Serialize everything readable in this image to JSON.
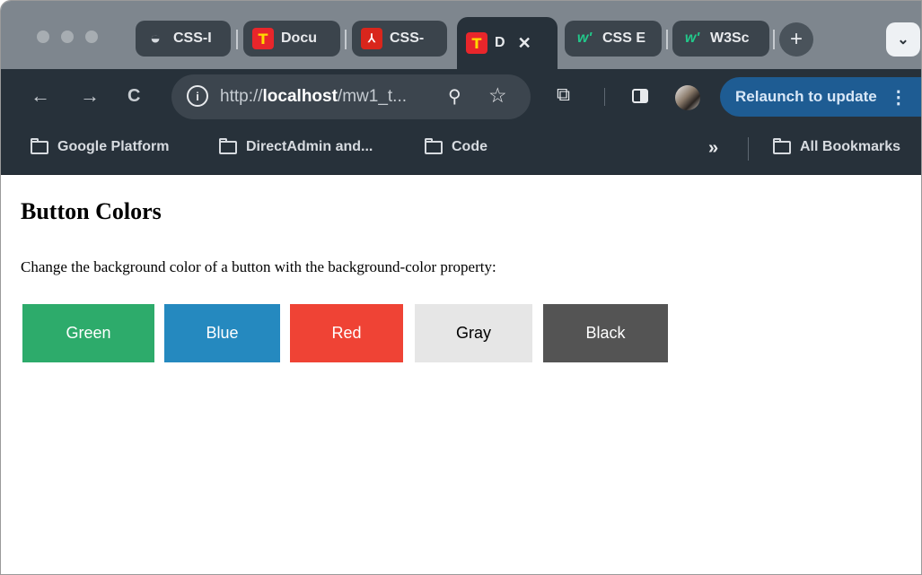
{
  "tabs": [
    {
      "label": "CSS-I",
      "icon": "globe-icon"
    },
    {
      "label": "Docu",
      "icon": "t-icon"
    },
    {
      "label": "CSS-",
      "icon": "pdf-icon"
    },
    {
      "label": "D",
      "icon": "t-icon",
      "active": true
    },
    {
      "label": "CSS E",
      "icon": "w3schools-icon"
    },
    {
      "label": "W3Sc",
      "icon": "w3schools-icon"
    }
  ],
  "tab_icon_glyphs": {
    "t": "T",
    "pdf": "⅄",
    "w": "w'",
    "globe": "◒"
  },
  "tab_close_glyph": "✕",
  "new_tab_glyph": "+",
  "tab_menu_glyph": "⌄",
  "toolbar": {
    "back_glyph": "←",
    "forward_glyph": "→",
    "reload_glyph": "C",
    "info_glyph": "i",
    "url_prefix": "http://",
    "url_host": "localhost",
    "url_rest": "/mw1_t...",
    "zoom_glyph": "⚲",
    "star_glyph": "☆",
    "extensions_glyph": "⧉",
    "relaunch_label": "Relaunch to update",
    "relaunch_menu_glyph": "⋮"
  },
  "bookmarks": {
    "items": [
      "Google Platform",
      "DirectAdmin and...",
      "Code"
    ],
    "overflow_glyph": "»",
    "all_bookmarks": "All Bookmarks"
  },
  "page": {
    "heading": "Button Colors",
    "description": "Change the background color of a button with the background-color property:",
    "buttons": [
      {
        "label": "Green",
        "bg": "#2dab6b",
        "fg": "#ffffff"
      },
      {
        "label": "Blue",
        "bg": "#2589bf",
        "fg": "#ffffff"
      },
      {
        "label": "Red",
        "bg": "#ef4335",
        "fg": "#ffffff"
      },
      {
        "label": "Gray",
        "bg": "#e6e6e6",
        "fg": "#000000"
      },
      {
        "label": "Black",
        "bg": "#545454",
        "fg": "#ffffff"
      }
    ]
  },
  "colors": {
    "tabstrip": "#7e868e",
    "toolbar": "#27313a",
    "relaunch": "#1e5c93"
  }
}
